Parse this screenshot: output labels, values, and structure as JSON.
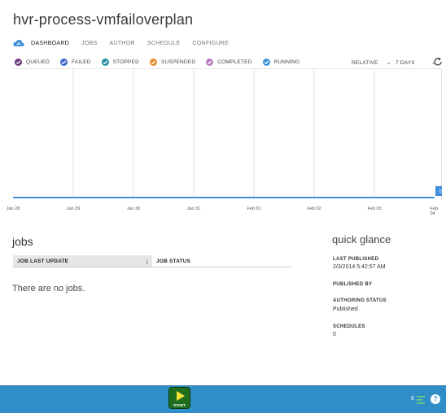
{
  "page": {
    "title": "hvr-process-vmfailoverplan"
  },
  "tabs": [
    {
      "label": "DASHBOARD",
      "active": true
    },
    {
      "label": "JOBS"
    },
    {
      "label": "AUTHOR"
    },
    {
      "label": "SCHEDULE"
    },
    {
      "label": "CONFIGURE"
    }
  ],
  "legend": [
    {
      "label": "QUEUED",
      "color": "#6b3a7a"
    },
    {
      "label": "FAILED",
      "color": "#3b67c8"
    },
    {
      "label": "STOPPED",
      "color": "#1f8fa0"
    },
    {
      "label": "SUSPENDED",
      "color": "#e3892b"
    },
    {
      "label": "COMPLETED",
      "color": "#b57ab9"
    },
    {
      "label": "RUNNING",
      "color": "#3e8fdc"
    }
  ],
  "controls": {
    "relative": "RELATIVE",
    "range": "7 DAYS"
  },
  "chart_data": {
    "type": "line",
    "x": [
      "Jan 28",
      "Jan 29",
      "Jan 30",
      "Jan 31",
      "Feb 01",
      "Feb 02",
      "Feb 03",
      "Feb 04"
    ],
    "series": [
      {
        "values": [
          0,
          0,
          0,
          0,
          0,
          0,
          0,
          0
        ]
      }
    ],
    "data_label": "0",
    "series_color": "#3e8fdc"
  },
  "jobs": {
    "title": "jobs",
    "columns": [
      "JOB LAST UPDATE",
      "JOB STATUS"
    ],
    "sort_icon": "down-arrow",
    "empty_text": "There are no jobs."
  },
  "quick_glance": {
    "title": "quick glance",
    "items": [
      {
        "label": "LAST PUBLISHED",
        "value": "2/3/2014 5:42:57 AM"
      },
      {
        "label": "PUBLISHED BY",
        "value": ""
      },
      {
        "label": "AUTHORING STATUS",
        "value": "Published"
      },
      {
        "label": "SCHEDULES",
        "value": "0"
      }
    ]
  },
  "command_bar": {
    "start_label": "START",
    "count": "6",
    "help": "?"
  }
}
